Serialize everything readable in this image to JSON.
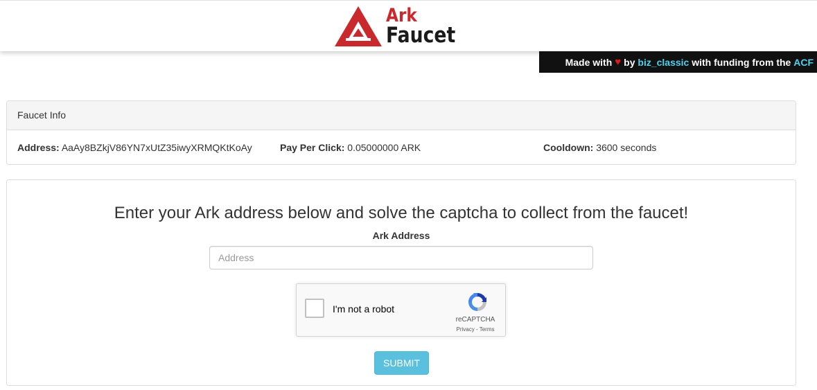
{
  "header": {
    "logo": {
      "line1": "Ark",
      "line2": "Faucet",
      "icon": "ark-triangle-logo-icon",
      "color": "#c9292c"
    },
    "credits": {
      "prefix": "Made with",
      "heart": "♥",
      "by": "by",
      "author": "biz_classic",
      "middle": "with funding from the",
      "funder": "ACF",
      "link_color": "#4fd2ee"
    }
  },
  "faucet_info": {
    "title": "Faucet Info",
    "address_label": "Address:",
    "address_value": "AaAy8BZkjV86YN7xUtZ35iwyXRMQKtKoAy",
    "pay_label": "Pay Per Click:",
    "pay_value": "0.05000000 ARK",
    "cooldown_label": "Cooldown:",
    "cooldown_value": "3600 seconds"
  },
  "form": {
    "headline": "Enter your Ark address below and solve the captcha to collect from the faucet!",
    "address_label": "Ark Address",
    "address_placeholder": "Address",
    "address_value": "",
    "captcha": {
      "label": "I'm not a robot",
      "brand": "reCAPTCHA",
      "links": "Privacy - Terms",
      "checked": false
    },
    "submit_label": "SUBMIT",
    "submit_color": "#5bc0de"
  }
}
